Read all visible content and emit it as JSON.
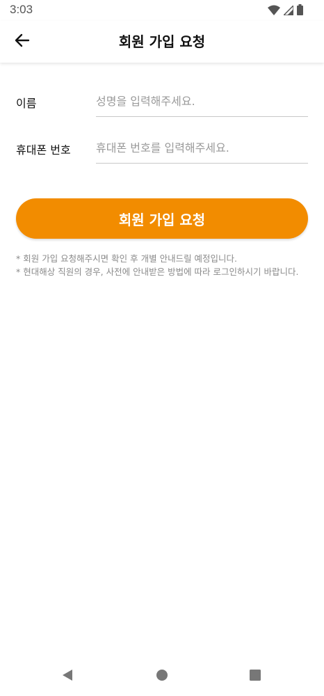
{
  "status_bar": {
    "time": "3:03",
    "icons": [
      "wifi-icon",
      "signal-icon",
      "battery-icon"
    ]
  },
  "app_bar": {
    "back_icon": "arrow-left-icon",
    "title": "회원 가입 요청"
  },
  "form": {
    "name": {
      "label": "이름",
      "placeholder": "성명을 입력해주세요.",
      "value": ""
    },
    "phone": {
      "label": "휴대폰 번호",
      "placeholder": "휴대폰 번호를 입력해주세요.",
      "value": ""
    }
  },
  "submit": {
    "label": "회원 가입 요청",
    "color": "#F28C00"
  },
  "notes": [
    "* 회원 가입 요청해주시면 확인 후 개별 안내드릴 예정입니다.",
    "* 현대해상 직원의 경우, 사전에 안내받은 방법에 따라 로그인하시기 바랍니다."
  ],
  "nav_bar": {
    "icons": [
      "back-triangle-icon",
      "home-circle-icon",
      "recents-square-icon"
    ]
  }
}
